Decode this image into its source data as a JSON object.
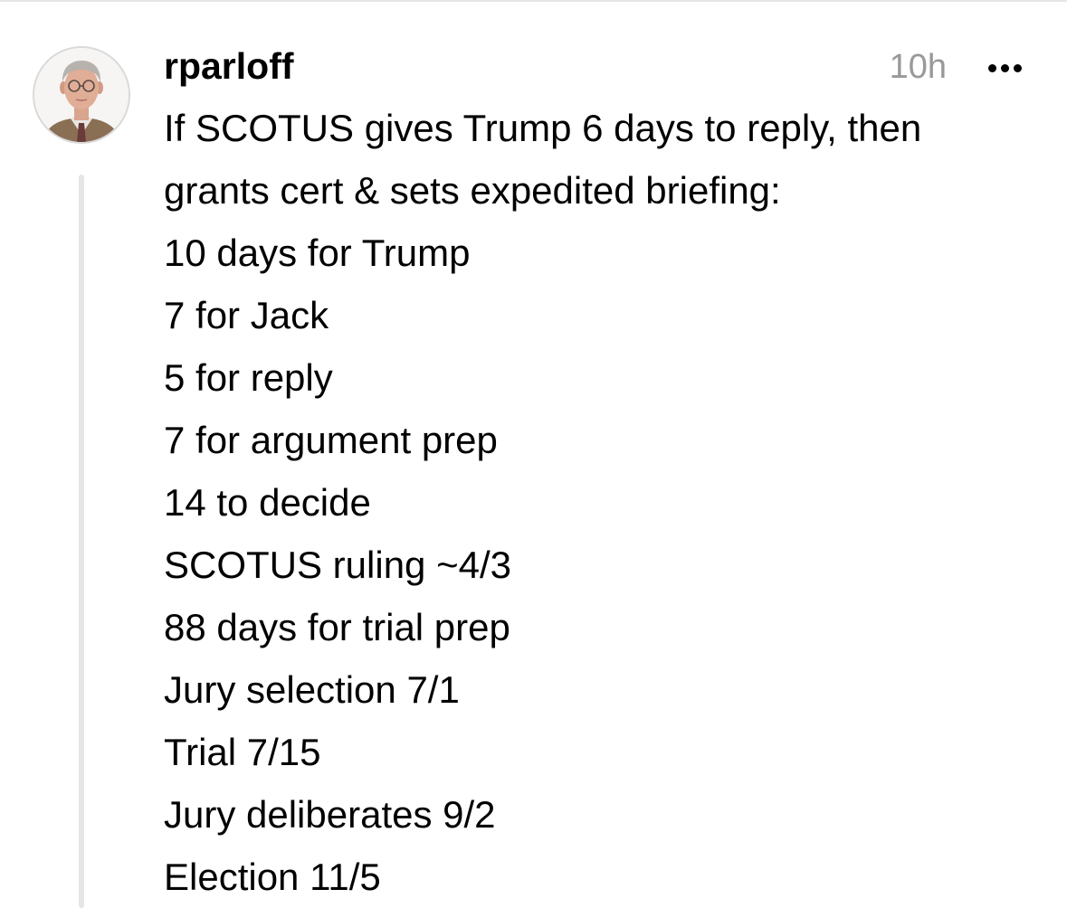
{
  "post": {
    "author": {
      "username": "rparloff",
      "avatar_icon": "user-avatar-photo"
    },
    "timestamp": "10h",
    "more_icon": "more-horizontal-icon",
    "lines": [
      "If SCOTUS gives Trump 6 days to reply, then",
      "grants cert & sets expedited briefing:",
      "10 days for Trump",
      "7 for Jack",
      "5 for reply",
      "7 for argument prep",
      "14 to decide",
      "SCOTUS ruling ~4/3",
      "88 days for trial prep",
      "Jury selection 7/1",
      "Trial 7/15",
      "Jury deliberates 9/2",
      "Election 11/5"
    ]
  },
  "colors": {
    "text": "#000000",
    "muted": "#999999",
    "divider": "#e6e6e6"
  }
}
